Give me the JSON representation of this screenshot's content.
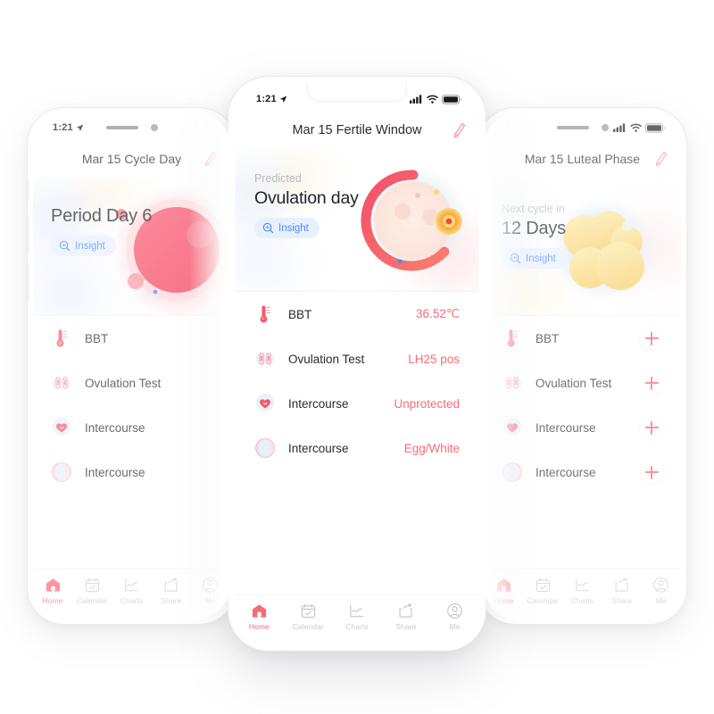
{
  "app": {
    "accent_pink": "#fa6a78",
    "accent_red": "#f5455c",
    "insight_blue": "#4a8cf7",
    "insight_bg": "#e8f0fe",
    "luteal_yellow": "#f9dd7e"
  },
  "phones": {
    "left": {
      "status": {
        "time": "1:21",
        "location_icon": "location-arrow-icon"
      },
      "header": {
        "title": "Mar 15 Cycle Day",
        "edit_icon": "pencil-icon"
      },
      "hero": {
        "subtitle": "",
        "title": "Period Day 6",
        "insight_label": "Insight",
        "graphic": "period-circle"
      },
      "rows": [
        {
          "icon": "thermometer-icon",
          "label": "BBT",
          "value": ""
        },
        {
          "icon": "ovulation-test-icon",
          "label": "Ovulation Test",
          "value": ""
        },
        {
          "icon": "intercourse-heart-icon",
          "label": "Intercourse",
          "value": ""
        },
        {
          "icon": "cervical-mucus-icon",
          "label": "Intercourse",
          "value": ""
        }
      ],
      "tabs": [
        {
          "icon": "home-icon",
          "label": "Home",
          "active": true
        },
        {
          "icon": "calendar-icon",
          "label": "Calendar",
          "active": false
        },
        {
          "icon": "charts-icon",
          "label": "Charts",
          "active": false
        },
        {
          "icon": "share-icon",
          "label": "Share",
          "active": false
        },
        {
          "icon": "me-icon",
          "label": "Me",
          "active": false
        }
      ]
    },
    "center": {
      "status": {
        "time": "1:21",
        "location_icon": "location-arrow-icon",
        "signal": "cellular-icon",
        "wifi": "wifi-icon",
        "battery": "battery-icon"
      },
      "header": {
        "title": "Mar 15 Fertile Window",
        "edit_icon": "pencil-icon"
      },
      "hero": {
        "subtitle": "Predicted",
        "title": "Ovulation day",
        "insight_label": "Insight",
        "graphic": "ovulation-ring"
      },
      "rows": [
        {
          "icon": "thermometer-icon",
          "label": "BBT",
          "value": "36.52℃"
        },
        {
          "icon": "ovulation-test-icon",
          "label": "Ovulation Test",
          "value": "LH25 pos"
        },
        {
          "icon": "intercourse-heart-icon",
          "label": "Intercourse",
          "value": "Unprotected"
        },
        {
          "icon": "cervical-mucus-icon",
          "label": "Intercourse",
          "value": "Egg/White"
        }
      ],
      "tabs": [
        {
          "icon": "home-icon",
          "label": "Home",
          "active": true
        },
        {
          "icon": "calendar-icon",
          "label": "Calendar",
          "active": false
        },
        {
          "icon": "charts-icon",
          "label": "Charts",
          "active": false
        },
        {
          "icon": "share-icon",
          "label": "Share",
          "active": false
        },
        {
          "icon": "me-icon",
          "label": "Me",
          "active": false
        }
      ]
    },
    "right": {
      "status": {
        "signal": "cellular-icon",
        "wifi": "wifi-icon",
        "battery": "battery-icon"
      },
      "header": {
        "title": "Mar 15 Luteal Phase",
        "edit_icon": "pencil-icon"
      },
      "hero": {
        "subtitle": "Next cycle in",
        "title": "12 Days",
        "insight_label": "Insight",
        "graphic": "luteal-cluster"
      },
      "rows": [
        {
          "icon": "thermometer-icon",
          "label": "BBT",
          "value": "",
          "add": "+"
        },
        {
          "icon": "ovulation-test-icon",
          "label": "Ovulation Test",
          "value": "",
          "add": "+"
        },
        {
          "icon": "intercourse-heart-icon",
          "label": "Intercourse",
          "value": "",
          "add": "+"
        },
        {
          "icon": "cervical-mucus-icon",
          "label": "Intercourse",
          "value": "",
          "add": "+"
        }
      ],
      "tabs": [
        {
          "icon": "home-icon",
          "label": "Home",
          "active": true
        },
        {
          "icon": "calendar-icon",
          "label": "Calendar",
          "active": false
        },
        {
          "icon": "charts-icon",
          "label": "Charts",
          "active": false
        },
        {
          "icon": "share-icon",
          "label": "Share",
          "active": false
        },
        {
          "icon": "me-icon",
          "label": "Me",
          "active": false
        }
      ]
    }
  }
}
